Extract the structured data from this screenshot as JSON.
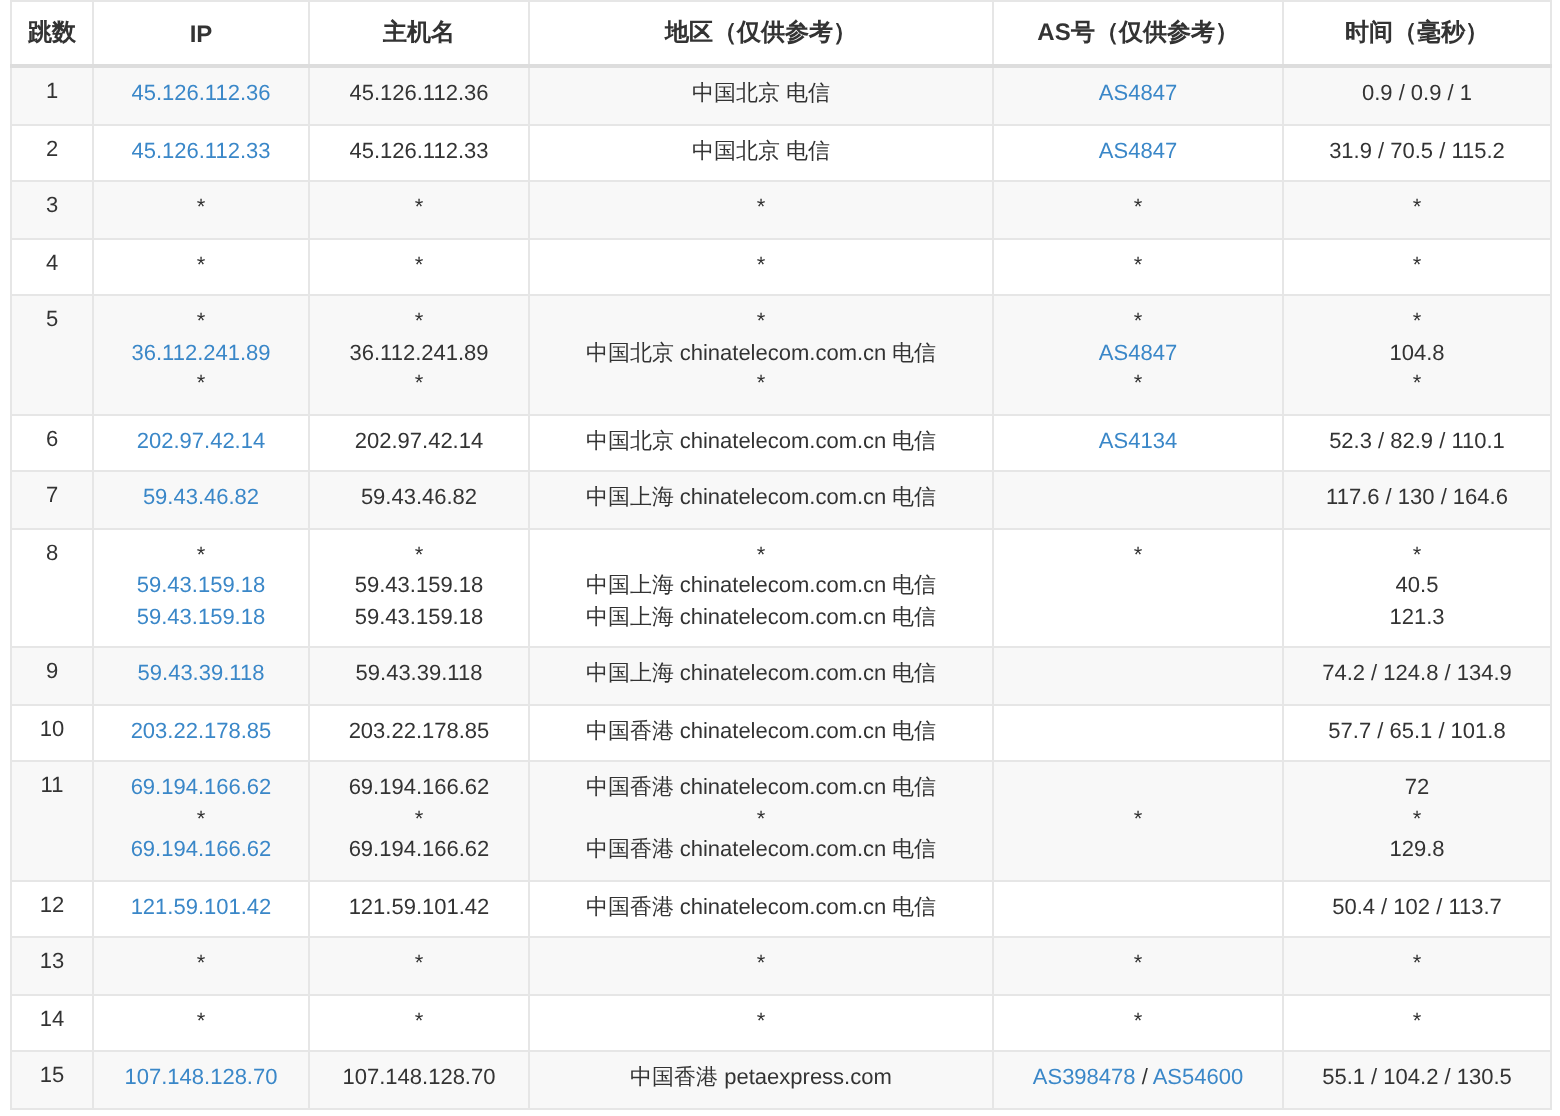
{
  "table": {
    "columns": [
      "跳数",
      "IP",
      "主机名",
      "地区（仅供参考）",
      "AS号（仅供参考）",
      "时间（毫秒）"
    ],
    "rows": [
      {
        "hop": "1",
        "ip": [
          [
            {
              "t": "45.126.112.36",
              "link": true
            }
          ]
        ],
        "host": [
          "45.126.112.36"
        ],
        "region": [
          "中国北京 电信"
        ],
        "as": [
          [
            {
              "t": "AS4847",
              "link": true
            }
          ]
        ],
        "time": [
          "0.9 / 0.9 / 1"
        ]
      },
      {
        "hop": "2",
        "ip": [
          [
            {
              "t": "45.126.112.33",
              "link": true
            }
          ]
        ],
        "host": [
          "45.126.112.33"
        ],
        "region": [
          "中国北京 电信"
        ],
        "as": [
          [
            {
              "t": "AS4847",
              "link": true
            }
          ]
        ],
        "time": [
          "31.9 / 70.5 / 115.2"
        ]
      },
      {
        "hop": "3",
        "ip": [
          [
            {
              "t": "*",
              "link": false
            }
          ]
        ],
        "host": [
          "*"
        ],
        "region": [
          "*"
        ],
        "as": [
          [
            {
              "t": "*",
              "link": false
            }
          ]
        ],
        "time": [
          "*"
        ]
      },
      {
        "hop": "4",
        "ip": [
          [
            {
              "t": "*",
              "link": false
            }
          ]
        ],
        "host": [
          "*"
        ],
        "region": [
          "*"
        ],
        "as": [
          [
            {
              "t": "*",
              "link": false
            }
          ]
        ],
        "time": [
          "*"
        ]
      },
      {
        "hop": "5",
        "ip": [
          [
            {
              "t": "*",
              "link": false
            }
          ],
          [
            {
              "t": "36.112.241.89",
              "link": true
            }
          ],
          [
            {
              "t": "*",
              "link": false
            }
          ]
        ],
        "host": [
          "*",
          "36.112.241.89",
          "*"
        ],
        "region": [
          "*",
          "中国北京 chinatelecom.com.cn 电信",
          "*"
        ],
        "as": [
          [
            {
              "t": "*",
              "link": false
            }
          ],
          [
            {
              "t": "AS4847",
              "link": true
            }
          ],
          [
            {
              "t": "*",
              "link": false
            }
          ]
        ],
        "time": [
          "*",
          "104.8",
          "*"
        ]
      },
      {
        "hop": "6",
        "ip": [
          [
            {
              "t": "202.97.42.14",
              "link": true
            }
          ]
        ],
        "host": [
          "202.97.42.14"
        ],
        "region": [
          "中国北京 chinatelecom.com.cn 电信"
        ],
        "as": [
          [
            {
              "t": "AS4134",
              "link": true
            }
          ]
        ],
        "time": [
          "52.3 / 82.9 / 110.1"
        ]
      },
      {
        "hop": "7",
        "ip": [
          [
            {
              "t": "59.43.46.82",
              "link": true
            }
          ]
        ],
        "host": [
          "59.43.46.82"
        ],
        "region": [
          "中国上海 chinatelecom.com.cn 电信"
        ],
        "as": [],
        "time": [
          "117.6 / 130 / 164.6"
        ]
      },
      {
        "hop": "8",
        "ip": [
          [
            {
              "t": "*",
              "link": false
            }
          ],
          [
            {
              "t": "59.43.159.18",
              "link": true
            }
          ],
          [
            {
              "t": "59.43.159.18",
              "link": true
            }
          ]
        ],
        "host": [
          "*",
          "59.43.159.18",
          "59.43.159.18"
        ],
        "region": [
          "*",
          "中国上海 chinatelecom.com.cn 电信",
          "中国上海 chinatelecom.com.cn 电信"
        ],
        "as": [
          [
            {
              "t": "*",
              "link": false
            }
          ]
        ],
        "time": [
          "*",
          "40.5",
          "121.3"
        ]
      },
      {
        "hop": "9",
        "ip": [
          [
            {
              "t": "59.43.39.118",
              "link": true
            }
          ]
        ],
        "host": [
          "59.43.39.118"
        ],
        "region": [
          "中国上海 chinatelecom.com.cn 电信"
        ],
        "as": [],
        "time": [
          "74.2 / 124.8 / 134.9"
        ]
      },
      {
        "hop": "10",
        "ip": [
          [
            {
              "t": "203.22.178.85",
              "link": true
            }
          ]
        ],
        "host": [
          "203.22.178.85"
        ],
        "region": [
          "中国香港 chinatelecom.com.cn 电信"
        ],
        "as": [],
        "time": [
          "57.7 / 65.1 / 101.8"
        ]
      },
      {
        "hop": "11",
        "ip": [
          [
            {
              "t": "69.194.166.62",
              "link": true
            }
          ],
          [
            {
              "t": "*",
              "link": false
            }
          ],
          [
            {
              "t": "69.194.166.62",
              "link": true
            }
          ]
        ],
        "host": [
          "69.194.166.62",
          "*",
          "69.194.166.62"
        ],
        "region": [
          "中国香港 chinatelecom.com.cn 电信",
          "*",
          "中国香港 chinatelecom.com.cn 电信"
        ],
        "as_centered": true,
        "as": [
          [
            {
              "t": "*",
              "link": false
            }
          ]
        ],
        "time": [
          "72",
          "*",
          "129.8"
        ]
      },
      {
        "hop": "12",
        "ip": [
          [
            {
              "t": "121.59.101.42",
              "link": true
            }
          ]
        ],
        "host": [
          "121.59.101.42"
        ],
        "region": [
          "中国香港 chinatelecom.com.cn 电信"
        ],
        "as": [],
        "time": [
          "50.4 / 102 / 113.7"
        ]
      },
      {
        "hop": "13",
        "ip": [
          [
            {
              "t": "*",
              "link": false
            }
          ]
        ],
        "host": [
          "*"
        ],
        "region": [
          "*"
        ],
        "as": [
          [
            {
              "t": "*",
              "link": false
            }
          ]
        ],
        "time": [
          "*"
        ]
      },
      {
        "hop": "14",
        "ip": [
          [
            {
              "t": "*",
              "link": false
            }
          ]
        ],
        "host": [
          "*"
        ],
        "region": [
          "*"
        ],
        "as": [
          [
            {
              "t": "*",
              "link": false
            }
          ]
        ],
        "time": [
          "*"
        ]
      },
      {
        "hop": "15",
        "ip": [
          [
            {
              "t": "107.148.128.70",
              "link": true
            }
          ]
        ],
        "host": [
          "107.148.128.70"
        ],
        "region": [
          "中国香港 petaexpress.com"
        ],
        "as": [
          [
            {
              "t": "AS398478",
              "link": true
            },
            {
              "t": " / ",
              "link": false
            },
            {
              "t": "AS54600",
              "link": true
            }
          ]
        ],
        "time": [
          "55.1 / 104.2 / 130.5"
        ]
      }
    ]
  }
}
